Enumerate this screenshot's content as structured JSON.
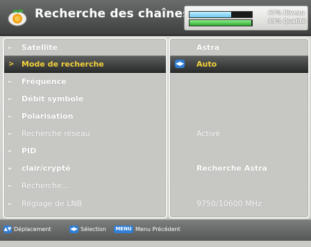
{
  "header": {
    "title": "Recherche des chaînes",
    "level_text": "67% Niveau",
    "quality_text": "99% Qualité",
    "level_percent": 67,
    "quality_percent": 99
  },
  "menu": {
    "items": [
      {
        "label": "Satellite",
        "value": "Astra"
      },
      {
        "label": "Mode de recherche",
        "value": "Auto",
        "selected": true
      },
      {
        "label": "Fréquence",
        "value": ""
      },
      {
        "label": "Débit symbole",
        "value": ""
      },
      {
        "label": "Polarisation",
        "value": ""
      },
      {
        "label": "Recherche réseau",
        "value": "Activé"
      },
      {
        "label": "PID",
        "value": ""
      },
      {
        "label": "clair/crypté",
        "value": "Recherche Astra"
      },
      {
        "label": "Recherche...",
        "value": ""
      },
      {
        "label": "Réglage de LNB",
        "value": "9750/10600 MHz"
      }
    ]
  },
  "footer": {
    "nav_label": "Déplacement",
    "select_label": "Sélection",
    "menu_key": "MENU",
    "menu_label": "Menu Précédent"
  },
  "colors": {
    "highlight_text": "#f4d23a",
    "key_blue": "#2f7fd8",
    "level_bar": "#6fc7ef",
    "quality_bar": "#2fa82f"
  }
}
